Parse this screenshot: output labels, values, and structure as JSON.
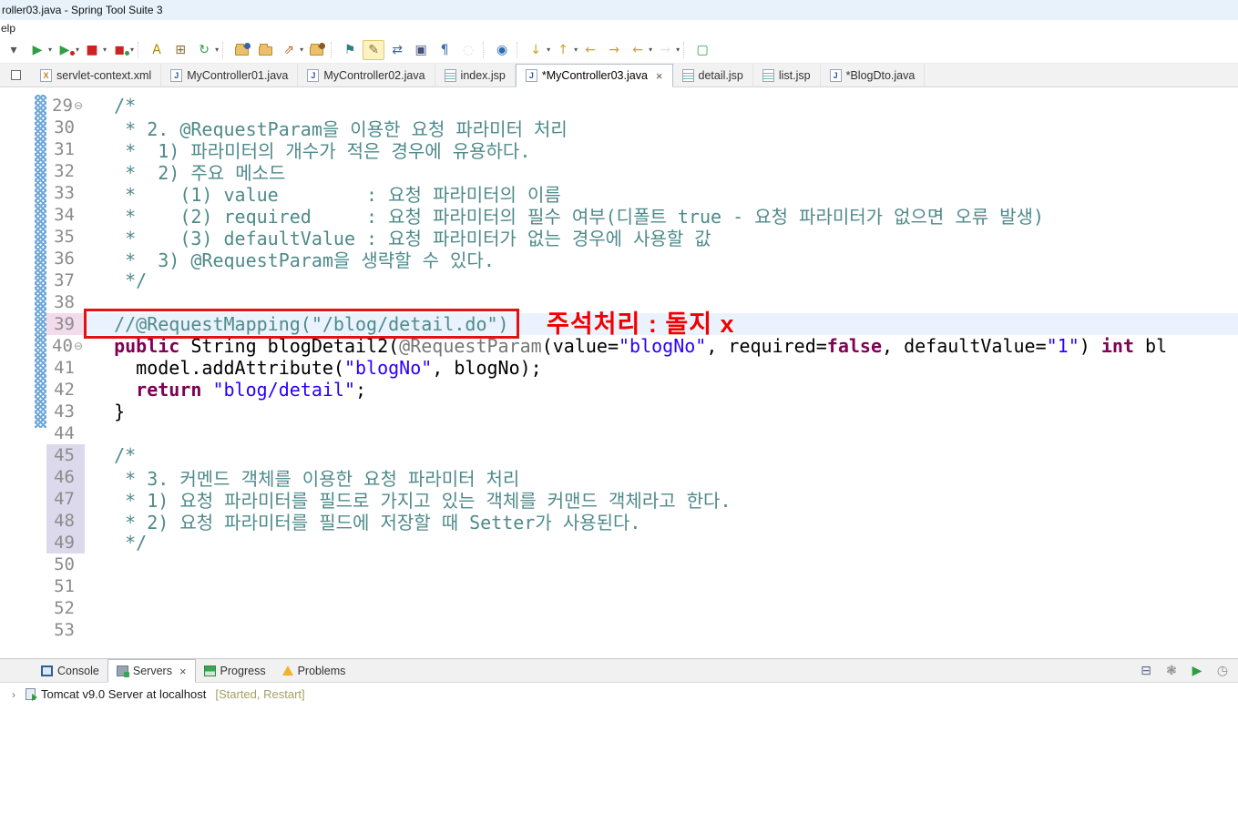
{
  "window": {
    "title": "roller03.java - Spring Tool Suite 3"
  },
  "menubar": {
    "visible_text": "elp"
  },
  "toolbar": {
    "items": [
      {
        "name": "toolbar-overflow-caret",
        "k": "glyph",
        "g": "▾",
        "c": "#555"
      },
      {
        "name": "run-button",
        "k": "glyph",
        "g": "▶",
        "c": "#2f9e44",
        "caret": true
      },
      {
        "name": "coverage-button",
        "k": "glyph",
        "g": "▶",
        "c": "#2f9e44",
        "dot": "#cc2222",
        "caret": true
      },
      {
        "name": "stop-button",
        "k": "glyph",
        "g": "■",
        "c": "#cc2222",
        "caret": true
      },
      {
        "name": "relaunch-button",
        "k": "glyph",
        "g": "◼",
        "c": "#cc2222",
        "dot": "#2f9e44",
        "caret": true
      },
      {
        "k": "sep"
      },
      {
        "name": "new-class-wizard-button",
        "k": "glyph",
        "g": "A",
        "c": "#b8860b"
      },
      {
        "name": "new-package-wizard-button",
        "k": "glyph",
        "g": "⊞",
        "c": "#8a6d3b"
      },
      {
        "name": "refresh-button",
        "k": "glyph",
        "g": "↻",
        "c": "#2f9e44",
        "caret": true
      },
      {
        "k": "sep"
      },
      {
        "name": "open-type-button",
        "k": "folder",
        "dot": "#3465a4"
      },
      {
        "name": "open-resource-button",
        "k": "folder"
      },
      {
        "name": "launch-button",
        "k": "glyph",
        "g": "⇗",
        "c": "#b06a2a",
        "caret": true
      },
      {
        "name": "search-folder-button",
        "k": "folder",
        "dot": "#8a5a2a"
      },
      {
        "k": "sep"
      },
      {
        "name": "pin-class-button",
        "k": "glyph",
        "g": "⚑",
        "c": "#2f7f7f"
      },
      {
        "name": "mark-occurrences-button",
        "k": "glyph",
        "g": "✎",
        "c": "#8a6d3b",
        "active": true
      },
      {
        "name": "link-with-editor-button",
        "k": "glyph",
        "g": "⇄",
        "c": "#3465a4"
      },
      {
        "name": "show-selected-element-button",
        "k": "glyph",
        "g": "▣",
        "c": "#44527a"
      },
      {
        "name": "show-whitespace-button",
        "k": "glyph",
        "g": "¶",
        "c": "#3b6ea5"
      },
      {
        "name": "disabled-tool-button",
        "k": "glyph",
        "g": "◌",
        "c": "#999",
        "dim": true
      },
      {
        "k": "sep"
      },
      {
        "name": "open-web-browser-button",
        "k": "glyph",
        "g": "◉",
        "c": "#2b6cb0"
      },
      {
        "k": "sep"
      },
      {
        "name": "next-annotation-button",
        "k": "glyph",
        "g": "↓",
        "c": "#c9a227",
        "caret": true
      },
      {
        "name": "previous-annotation-button",
        "k": "glyph",
        "g": "↑",
        "c": "#c9a227",
        "caret": true
      },
      {
        "name": "previous-edit-location-button",
        "k": "glyph",
        "g": "←",
        "c": "#c9a227"
      },
      {
        "name": "next-edit-location-button",
        "k": "glyph",
        "g": "→",
        "c": "#c9a227"
      },
      {
        "name": "back-button",
        "k": "glyph",
        "g": "←",
        "c": "#c9a227",
        "caret": true
      },
      {
        "name": "forward-button",
        "k": "glyph",
        "g": "→",
        "c": "#b5b5b5",
        "caret": true,
        "dim": true
      },
      {
        "k": "sep"
      },
      {
        "name": "pin-editor-button",
        "k": "glyph",
        "g": "▢",
        "c": "#2f9e44"
      }
    ]
  },
  "editor_tabs": [
    {
      "label": "servlet-context.xml",
      "type": "xml",
      "letter": "X"
    },
    {
      "label": "MyController01.java",
      "type": "java",
      "letter": "J"
    },
    {
      "label": "MyController02.java",
      "type": "java",
      "letter": "J"
    },
    {
      "label": "index.jsp",
      "type": "jsp",
      "letter": ""
    },
    {
      "label": "*MyController03.java",
      "type": "java",
      "letter": "J",
      "active": true,
      "close": "×"
    },
    {
      "label": "detail.jsp",
      "type": "jsp",
      "letter": ""
    },
    {
      "label": "list.jsp",
      "type": "jsp",
      "letter": ""
    },
    {
      "label": "*BlogDto.java",
      "type": "java",
      "letter": "J"
    }
  ],
  "editor": {
    "annotation_label": "주석처리 : 돌지 x",
    "annotation_color": "#f00000",
    "highlight_box_color": "#e31212",
    "colors": {
      "comment": "#4f8a8b",
      "keyword": "#7f0055",
      "string": "#2a00ff",
      "annotation": "#767676",
      "current_line": "#eaf3fd"
    },
    "lines": [
      {
        "n": "29",
        "fold": "⊖",
        "segs": [
          [
            "cm",
            "  /*"
          ]
        ]
      },
      {
        "n": "30",
        "segs": [
          [
            "cm",
            "   * 2. @RequestParam을 이용한 요청 파라미터 처리"
          ]
        ]
      },
      {
        "n": "31",
        "segs": [
          [
            "cm",
            "   *  1) 파라미터의 개수가 적은 경우에 유용하다."
          ]
        ]
      },
      {
        "n": "32",
        "segs": [
          [
            "cm",
            "   *  2) 주요 메소드"
          ]
        ]
      },
      {
        "n": "33",
        "segs": [
          [
            "cm",
            "   *    (1) value        : 요청 파라미터의 이름"
          ]
        ]
      },
      {
        "n": "34",
        "segs": [
          [
            "cm",
            "   *    (2) required     : 요청 파라미터의 필수 여부(디폴트 true - 요청 파라미터가 없으면 오류 발생)"
          ]
        ]
      },
      {
        "n": "35",
        "segs": [
          [
            "cm",
            "   *    (3) defaultValue : 요청 파라미터가 없는 경우에 사용할 값"
          ]
        ]
      },
      {
        "n": "36",
        "segs": [
          [
            "cm",
            "   *  3) @RequestParam을 생략할 수 있다."
          ]
        ]
      },
      {
        "n": "37",
        "segs": [
          [
            "cm",
            "   */"
          ]
        ]
      },
      {
        "n": "38",
        "segs": []
      },
      {
        "n": "39",
        "cur": true,
        "numbg": "pink",
        "segs": [
          [
            "cm",
            "  //@RequestMapping(\"/"
          ],
          [
            "cmw",
            "blog"
          ],
          [
            "cm",
            "/detail.do\")"
          ]
        ]
      },
      {
        "n": "40",
        "fold": "⊖",
        "segs": [
          [
            "pl",
            "  "
          ],
          [
            "kw",
            "public"
          ],
          [
            "pl",
            " String blogDetail2("
          ],
          [
            "an",
            "@RequestParam"
          ],
          [
            "pl",
            "(value="
          ],
          [
            "st",
            "\"blogNo\""
          ],
          [
            "pl",
            ", required="
          ],
          [
            "kw",
            "false"
          ],
          [
            "pl",
            ", defaultValue="
          ],
          [
            "st",
            "\"1\""
          ],
          [
            "pl",
            ") "
          ],
          [
            "kw",
            "int"
          ],
          [
            "pl",
            " bl"
          ]
        ]
      },
      {
        "n": "41",
        "segs": [
          [
            "pl",
            "    model.addAttribute("
          ],
          [
            "st",
            "\"blogNo\""
          ],
          [
            "pl",
            ", blogNo);"
          ]
        ]
      },
      {
        "n": "42",
        "segs": [
          [
            "pl",
            "    "
          ],
          [
            "kw",
            "return"
          ],
          [
            "pl",
            " "
          ],
          [
            "st",
            "\"blog/detail\""
          ],
          [
            "pl",
            ";"
          ]
        ]
      },
      {
        "n": "43",
        "segs": [
          [
            "pl",
            "  }"
          ]
        ]
      },
      {
        "n": "44",
        "segs": []
      },
      {
        "n": "45",
        "numbg": "lav",
        "segs": [
          [
            "cm",
            "  /*"
          ]
        ]
      },
      {
        "n": "46",
        "numbg": "lav",
        "segs": [
          [
            "cm",
            "   * 3. 커멘드 객체를 이용한 요청 파라미터 처리"
          ]
        ]
      },
      {
        "n": "47",
        "numbg": "lav",
        "segs": [
          [
            "cm",
            "   * 1) 요청 파라미터를 필드로 가지고 있는 객체를 커맨드 객체라고 한다."
          ]
        ]
      },
      {
        "n": "48",
        "numbg": "lav",
        "segs": [
          [
            "cm",
            "   * 2) 요청 파라미터를 필드에 저장할 때 Setter가 사용된다."
          ]
        ]
      },
      {
        "n": "49",
        "numbg": "lav",
        "segs": [
          [
            "cm",
            "   */"
          ]
        ]
      },
      {
        "n": "50",
        "segs": []
      },
      {
        "n": "51",
        "segs": []
      },
      {
        "n": "52",
        "segs": []
      },
      {
        "n": "53",
        "segs": []
      }
    ]
  },
  "bottom": {
    "tabs": [
      {
        "label": "Console",
        "icon": "console"
      },
      {
        "label": "Servers",
        "icon": "servers",
        "active": true,
        "close": "×"
      },
      {
        "label": "Progress",
        "icon": "progress"
      },
      {
        "label": "Problems",
        "icon": "problems"
      }
    ],
    "toolbar_icons": [
      {
        "name": "collapse-all-icon",
        "g": "⊟",
        "c": "#5a6b8c"
      },
      {
        "name": "debug-server-icon",
        "g": "❃",
        "c": "#8a8a8a"
      },
      {
        "name": "start-server-icon",
        "g": "▶",
        "c": "#2f9e44"
      },
      {
        "name": "profile-server-icon",
        "g": "◷",
        "c": "#8a8a8a"
      }
    ],
    "server_row": {
      "expander": "›",
      "label": "Tomcat v9.0 Server at localhost",
      "status": "[Started, Restart]"
    }
  }
}
